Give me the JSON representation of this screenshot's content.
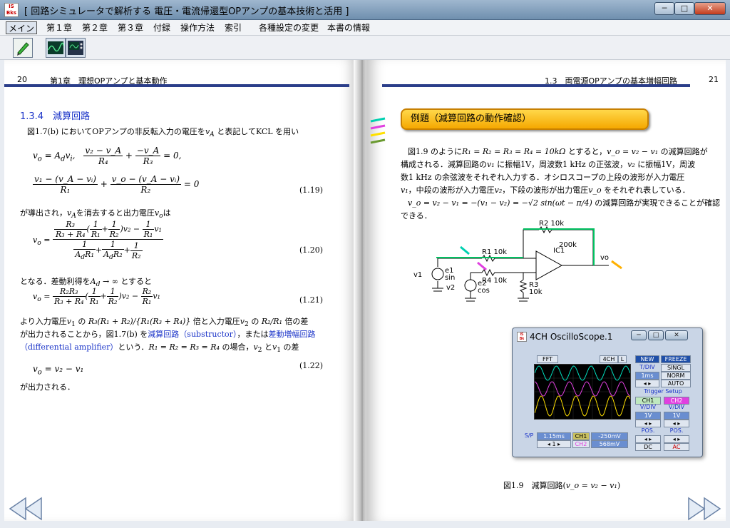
{
  "window": {
    "title": "[ 回路シミュレータで解析する 電圧・電流帰還型OPアンプの基本技術と活用 ]",
    "logo": "IS Books",
    "minimize": "─",
    "maximize": "□",
    "close": "✕"
  },
  "menu": {
    "items": [
      "メイン",
      "第１章",
      "第２章",
      "第３章",
      "付録",
      "操作方法",
      "索引",
      "各種設定の変更",
      "本書の情報"
    ]
  },
  "toolbar": {
    "icons": [
      "pen-icon",
      "waveform-icon",
      "oscilloscope-icon"
    ]
  },
  "left": {
    "page_number": "20",
    "header": "第1章　理想OPアンプと基本動作",
    "section": "1.3.4　減算回路",
    "p1": "図1.7(b) においてOPアンプの非反転入力の電圧を",
    "p1_var": "v",
    "p1_sub": "A",
    "p1_end": " と表記してKCL を用い",
    "eq_a": "v",
    "eq_a_sub": "o",
    "eq_a_rhs": " = A",
    "eq_a_rhs_sub": "d",
    "eq_a_rhs2": "v",
    "eq_a_rhs2_sub": "i",
    "eq1_n1": "v₂ − v_A",
    "eq1_d1": "R₄",
    "eq1_n2": "−v_A",
    "eq1_d2": "R₃",
    "eq1_tail": "= 0,",
    "eq2_n1": "v₁ − (v_A − vᵢ)",
    "eq2_d1": "R₁",
    "eq2_n2": "v_o − (v_A − vᵢ)",
    "eq2_d2": "R₂",
    "eq2_tail": "= 0",
    "eq_1_19": "(1.19)",
    "p2": "が導出され，",
    "p2_var": "v",
    "p2_var_sub": "A",
    "p2_mid": "を消去すると出力電圧",
    "p2_var2": "v",
    "p2_var2_sub": "o",
    "p2_end": "は",
    "eq_1_20": "(1.20)",
    "p3": "となる．差動利得を",
    "p3_var": "A",
    "p3_var_sub": "d",
    "p3_end": " → ∞ とすると",
    "eq_1_21": "(1.21)",
    "p4a": "より入力電圧",
    "p4a_v": "v",
    "p4a_v_sub": "1",
    "p4a_m1": " の ",
    "p4a_r": "R₃(R₁ + R₂)/{R₁(R₃ + R₄)}",
    "p4a_m2": " 倍と入力電圧",
    "p4a_v2": "v",
    "p4a_v2_sub": "2",
    "p4a_m3": " の ",
    "p4a_r2": "R₂/R₁",
    "p4a_end": " 倍の差",
    "p4b_start": "が出力されることから，図1.7(b) を",
    "p4b_link1": "減算回路（substructor）",
    "p4b_mid": "，または",
    "p4b_link2": "差動増幅回路",
    "p4c_link": "（differential amplifier）",
    "p4c_mid": "という．",
    "p4c_eq": "R₁ = R₂ = R₃ = R₄",
    "p4c_mid2": " の場合，",
    "p4c_v2": "v",
    "p4c_v2_sub": "2",
    "p4c_m3": " と",
    "p4c_v1": "v",
    "p4c_v1_sub": "1",
    "p4c_end": " の差",
    "eq_1_22_lhs": "v",
    "eq_1_22_lhs_sub": "o",
    "eq_1_22_rhs": " = v₂ − v₁",
    "eq_1_22": "(1.22)",
    "p5": "が出力される．"
  },
  "right": {
    "page_number": "21",
    "header": "1.3　両電源OPアンプの基本増幅回路",
    "example_title": "例題（減算回路の動作確認）",
    "t1": "図1.9 のように",
    "t1_eq": "R₁ = R₂ = R₃ = R₄ = 10kΩ",
    "t1_m": " とすると，",
    "t1_eq2": "v_o = v₂ − v₁",
    "t1_end": " の減算回路が",
    "t2": "構成される．減算回路の",
    "t2_v": "v₁",
    "t2_m": " に振幅1V，周波数1 kHz の正弦波，",
    "t2_v2": "v₂",
    "t2_end": " に振幅1V，周波",
    "t3": "数1 kHz の余弦波をそれぞれ入力する．オシロスコープの上段の波形が入力電圧",
    "t4_v": "v₁",
    "t4_m": "，中段の波形が入力電圧",
    "t4_v2": "v₂",
    "t4_m2": "，下段の波形が出力電圧",
    "t4_v3": "v_o",
    "t4_end": " をそれぞれ表している．",
    "t5_eq": "v_o = v₂ − v₁ = −(v₁ − v₂) = −√2 sin(ωt − π/4)",
    "t5_end": " の減算回路が実現できることが確認",
    "t6": "できる．",
    "caption": "図1.9　減算回路(",
    "caption_eq": "v_o = v₂ − v₁",
    "caption_end": ")",
    "circuit": {
      "r2": "R2 10k",
      "r1": "R1 10k",
      "r4": "R4 10k",
      "r3": "R3",
      "r3v": "10k",
      "ic": "IC1",
      "gain": "200k",
      "vo": "vo",
      "v1": "v1",
      "e1": "e1",
      "sin": "sin",
      "v2": "v2",
      "e2": "e2",
      "cos": "cos"
    }
  },
  "scope": {
    "title": "4CH OscilloScope.1",
    "logo": "IS Books",
    "fft": "FFT",
    "ch4": "4CH",
    "l": "L",
    "new": "NEW",
    "freeze": "FREEZE",
    "tdiv": "T/DIV",
    "tval": "1ms",
    "singl": "SINGL",
    "norm": "NORM",
    "auto": "AUTO",
    "trigger": "Trigger Setup",
    "ch1": "CH1",
    "ch2": "CH2",
    "vdiv1": "V/DIV",
    "vdiv2": "V/DIV",
    "v1": "1V",
    "v2": "1V",
    "pos1": "POS.",
    "pos2": "POS.",
    "dc": "DC",
    "ac": "AC",
    "sp": "S/P",
    "time": "1.15ms",
    "ch1b": "CH1",
    "ch2b": "CH2",
    "m1": "-250mV",
    "m2": "568mV",
    "step": "1"
  },
  "colors": {
    "accent": "#2b3e8a",
    "link": "#1a33c8",
    "example": "#f5b800",
    "ch1": "#00e0c0",
    "ch2": "#e040e0",
    "ch3": "#ffe000"
  }
}
